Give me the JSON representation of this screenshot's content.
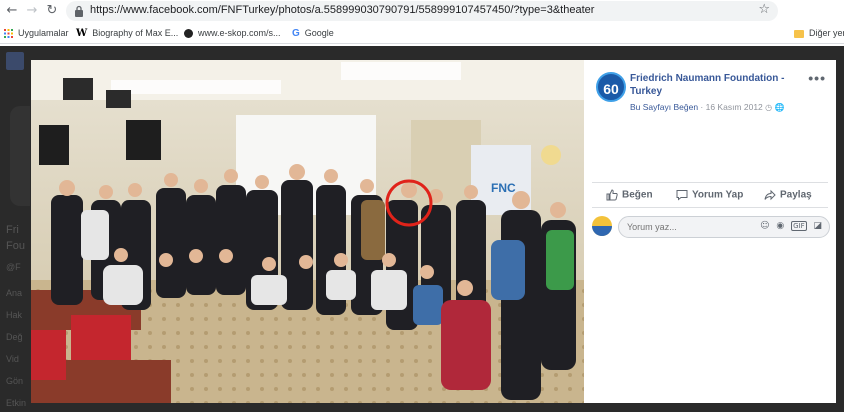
{
  "browser": {
    "url": "https://www.facebook.com/FNFTurkey/photos/a.558999030790791/558999107457450/?type=3&theater",
    "bookmarks": [
      {
        "label": "Uygulamalar",
        "icon": "apps-grid-icon"
      },
      {
        "label": "Biography of Max E...",
        "icon": "wikipedia-icon"
      },
      {
        "label": "www.e-skop.com/s...",
        "icon": "e-skop-icon"
      },
      {
        "label": "Google",
        "icon": "google-icon"
      },
      {
        "label": "Diğer yer",
        "icon": "folder-icon"
      }
    ]
  },
  "background_sidebar": [
    "Fri",
    "Fou",
    "@F",
    "Ana",
    "Hak",
    "Değ",
    "Vid",
    "Gön",
    "Etkin"
  ],
  "post": {
    "logo_text": "60",
    "page_name": "Friedrich Naumann Foundation - Turkey",
    "follow_label": "Bu Sayfayı Beğen",
    "separator": " · ",
    "date": "16 Kasım 2012",
    "more": "•••"
  },
  "actions": {
    "like": "Beğen",
    "comment": "Yorum Yap",
    "share": "Paylaş"
  },
  "comment": {
    "placeholder": "Yorum yaz..."
  },
  "colors": {
    "link": "#385898",
    "highlight_circle": "#e0231a"
  }
}
